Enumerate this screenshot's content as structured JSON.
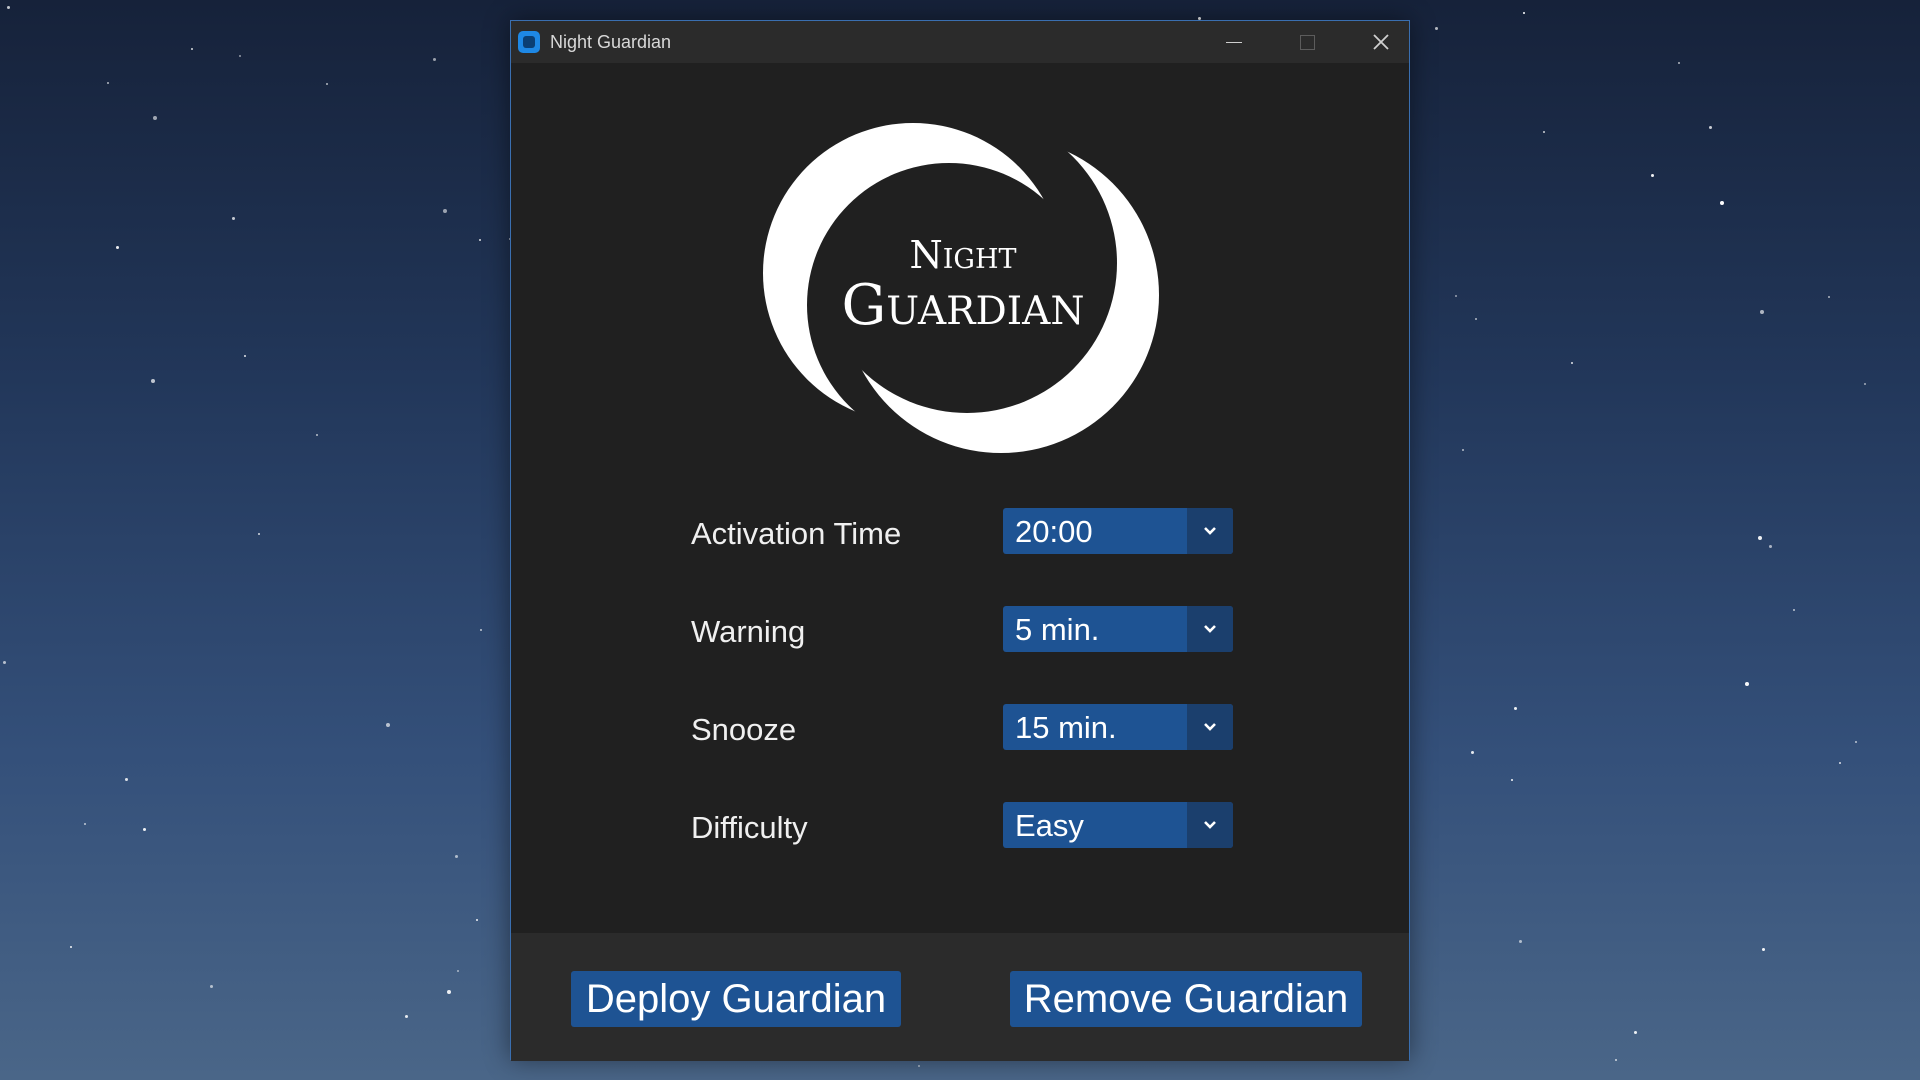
{
  "window": {
    "title": "Night Guardian",
    "app_icon": "app-icon",
    "controls": [
      "minimize-icon",
      "maximize-icon",
      "close-icon"
    ]
  },
  "logo": {
    "line1": "Night",
    "line2": "Guardian"
  },
  "settings": [
    {
      "label": "Activation Time",
      "value": "20:00"
    },
    {
      "label": "Warning",
      "value": "5 min."
    },
    {
      "label": "Snooze",
      "value": "15 min."
    },
    {
      "label": "Difficulty",
      "value": "Easy"
    }
  ],
  "buttons": {
    "deploy": "Deploy Guardian",
    "remove": "Remove Guardian"
  },
  "colors": {
    "window_bg": "#202020",
    "footer_bg": "#2b2b2b",
    "accent": "#1e5393",
    "dropdown_button": "#1b3f6d"
  }
}
